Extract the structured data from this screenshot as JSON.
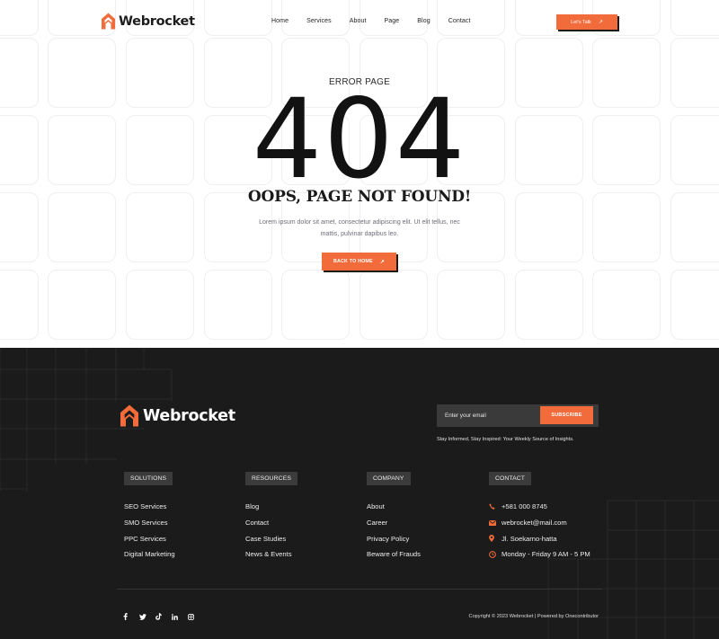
{
  "brand": {
    "name": "Webrocket",
    "accent": "#f26b3a"
  },
  "nav": {
    "items": [
      "Home",
      "Services",
      "About",
      "Page",
      "Blog",
      "Contact"
    ],
    "cta_label": "Let's Talk",
    "cta_icon": "arrow-up-right-icon"
  },
  "hero": {
    "eyebrow": "ERROR PAGE",
    "code": "404",
    "headline": "OOPS, PAGE NOT FOUND!",
    "description": "Lorem ipsum dolor sit amet, consectetur adipiscing elit. Ut elit tellus, nec mattis, pulvinar dapibus leo.",
    "button_label": "BACK TO HOME",
    "button_icon": "arrow-up-right-icon"
  },
  "footer": {
    "newsletter": {
      "placeholder": "Enter your email",
      "button_label": "SUBSCRIBE",
      "note": "Stay Informed, Stay Inspired: Your Weekly Source of  Insights."
    },
    "columns": [
      {
        "title": "SOLUTIONS",
        "items": [
          "SEO Services",
          "SMO Services",
          "PPC Services",
          "Digital Marketing"
        ]
      },
      {
        "title": "RESOURCES",
        "items": [
          "Blog",
          "Contact",
          "Case Studies",
          "News & Events"
        ]
      },
      {
        "title": "COMPANY",
        "items": [
          "About",
          "Career",
          "Privacy Policy",
          "Beware of Frauds"
        ]
      },
      {
        "title": "CONTACT",
        "items": [
          {
            "icon": "phone-icon",
            "text": "+581 000 8745"
          },
          {
            "icon": "mail-icon",
            "text": "webrocket@mail.com"
          },
          {
            "icon": "location-pin-icon",
            "text": "Jl. Soekarno-hatta"
          },
          {
            "icon": "clock-icon",
            "text": "Monday - Friday 9 AM - 5 PM"
          }
        ]
      }
    ],
    "socials": [
      "facebook-icon",
      "twitter-icon",
      "tiktok-icon",
      "linkedin-icon",
      "instagram-icon"
    ],
    "copyright": "Copyright © 2023 Webrocket | Powered by Onecontributor"
  }
}
